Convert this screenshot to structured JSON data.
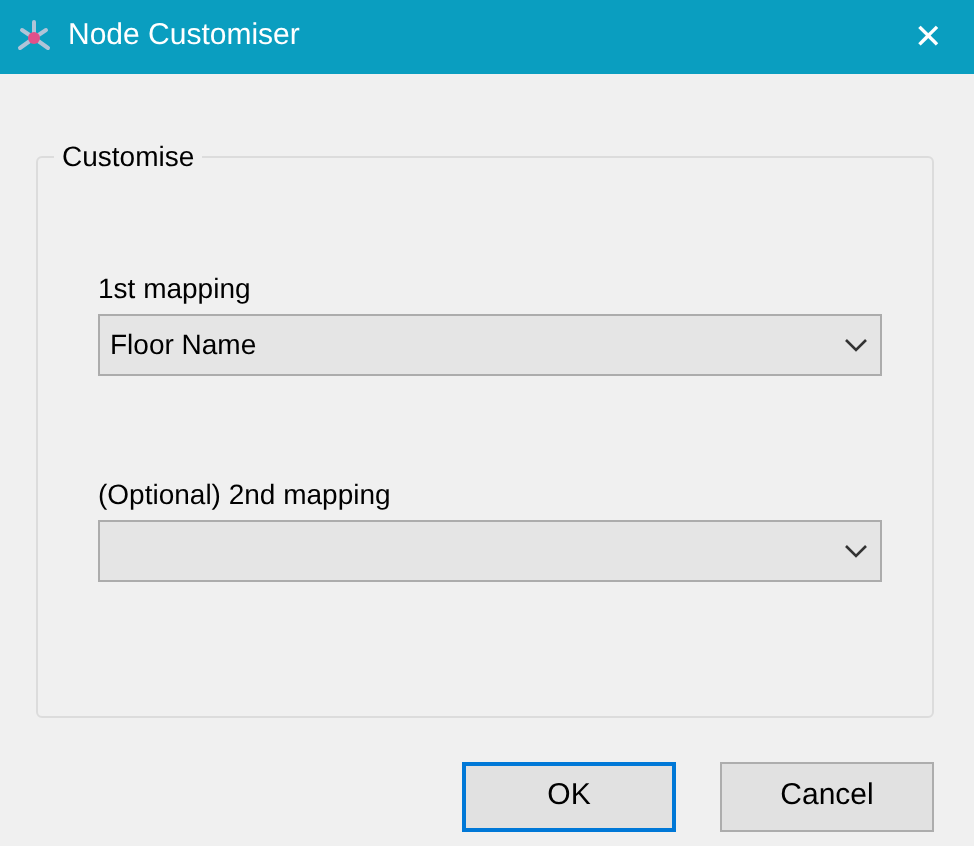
{
  "window": {
    "title": "Node Customiser",
    "close": "✕"
  },
  "group": {
    "title": "Customise",
    "fields": [
      {
        "label": "1st mapping",
        "value": "Floor Name"
      },
      {
        "label": "(Optional) 2nd mapping"
      }
    ]
  },
  "buttons": [
    {
      "label": "OK",
      "default": true
    },
    {
      "label": "Cancel",
      "default": false
    }
  ]
}
